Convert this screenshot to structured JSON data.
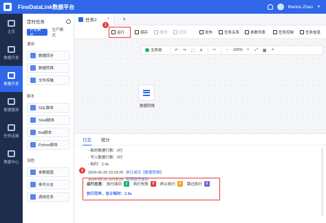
{
  "app": {
    "title": "FineDataLink数据平台",
    "user": "Marlon.Zhao"
  },
  "colors": {
    "primary": "#2f67e8",
    "nav_bg": "#1f2d4d",
    "highlight": "#e53935",
    "success": "#18b566",
    "fail": "#e53935",
    "stop": "#f0a020",
    "skip": "#7a5cd6"
  },
  "nav": [
    {
      "label": "主页",
      "icon": "home-icon",
      "active": false
    },
    {
      "label": "数据开发",
      "icon": "data-dev-icon",
      "active": true
    },
    {
      "label": "数据服务",
      "icon": "data-service-icon",
      "active": false
    },
    {
      "label": "任务运维",
      "icon": "ops-icon",
      "active": false
    },
    {
      "label": "数据中心",
      "icon": "data-center-icon",
      "active": false
    }
  ],
  "nav_extra": {
    "label": "数据开发"
  },
  "task_panel": {
    "header": "定时任务",
    "modes": [
      "开发模式",
      "生产模式"
    ],
    "sections": [
      {
        "label": "通用",
        "items": [
          "数据同步",
          "数据转换",
          "文件传输"
        ]
      },
      {
        "label": "脚本",
        "items": [
          "SQL脚本",
          "Shell脚本",
          "Bat脚本",
          "Python脚本"
        ]
      },
      {
        "label": "流程",
        "items": [
          "参数赋值",
          "条件分支",
          "调用任务"
        ]
      }
    ]
  },
  "tabs": [
    {
      "label": "任务2",
      "close": "×"
    }
  ],
  "tab_add": "+",
  "toolbar": {
    "run": "运行",
    "save": "保存",
    "undo": "撤销",
    "redo": "还原",
    "publish": "发布",
    "relations": "任务关系",
    "params": "参数列表",
    "control": "任务控制",
    "info": "任务信息"
  },
  "canvas": {
    "status": "无异常",
    "zoom": "100%",
    "node_label": "数据转换"
  },
  "annotations": {
    "marker1": "1",
    "marker2": "2"
  },
  "log": {
    "tabs": [
      "日志",
      "统计"
    ],
    "lines": [
      {
        "text": "- 新的数据行数：0行",
        "link": ""
      },
      {
        "text": "- 写入数据行数：0行",
        "link": ""
      },
      {
        "text": "- 耗时：2.4s",
        "link": ""
      },
      {
        "text": "2024-05-20 10:18:20",
        "link": "执行成功【数据转换】"
      },
      {
        "text": "2024-05-20 10:18:20",
        "link": "实例运行成功"
      }
    ],
    "summary": {
      "title": "运行总览:",
      "counts": [
        {
          "label": "执行成功",
          "value": "1",
          "color": "#18b566"
        },
        {
          "label": "执行失败",
          "value": "0",
          "color": "#e53935"
        },
        {
          "label": "终止执行",
          "value": "0",
          "color": "#f0a020"
        },
        {
          "label": "跳过执行",
          "value": "0",
          "color": "#7a5cd6"
        }
      ],
      "footer": "执行完毕，总计耗时：2.9s"
    }
  }
}
